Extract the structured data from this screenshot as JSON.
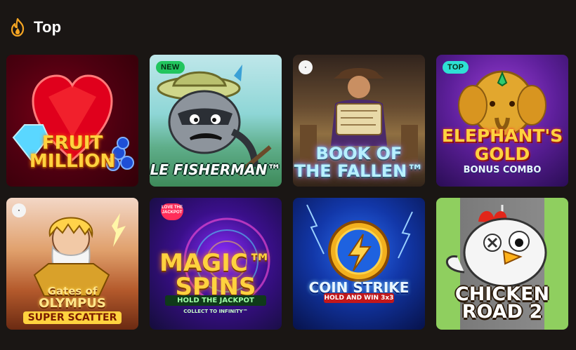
{
  "section": {
    "title": "Top",
    "icon": "flame-icon",
    "accent_color": "#f6a623"
  },
  "games": [
    {
      "id": "fruit-million",
      "title_line1": "FRUIT",
      "title_line2": "MILLION",
      "badge": ""
    },
    {
      "id": "le-fisherman",
      "title_line1": "LE FISHERMAN™",
      "badge": "NEW"
    },
    {
      "id": "book-of-the-fallen",
      "title_line1": "BOOK OF",
      "title_line2": "THE FALLEN™",
      "badge": ""
    },
    {
      "id": "elephants-gold",
      "title_line1": "ELEPHANT'S",
      "title_line2": "GOLD",
      "subtitle": "BONUS COMBO",
      "badge": "TOP"
    },
    {
      "id": "gates-of-olympus",
      "title_line1": "Gates of",
      "title_line2": "OLYMPUS",
      "subtitle": "SUPER SCATTER",
      "badge": ""
    },
    {
      "id": "magic-spins",
      "title_line1": "MAGIC™",
      "title_line2": "SPINS",
      "subtitle": "HOLD THE JACKPOT",
      "subtitle2": "COLLECT TO INFINITY™",
      "promo_label": "LOVE THE JACKPOT"
    },
    {
      "id": "coin-strike",
      "title_line1": "COIN STRIKE",
      "subtitle": "HOLD AND WIN 3x3"
    },
    {
      "id": "chicken-road-2",
      "title_line1": "CHICKEN",
      "title_line2": "ROAD 2"
    }
  ],
  "badges": {
    "new_color": "#22c55e",
    "top_color": "#2ee0d4"
  }
}
